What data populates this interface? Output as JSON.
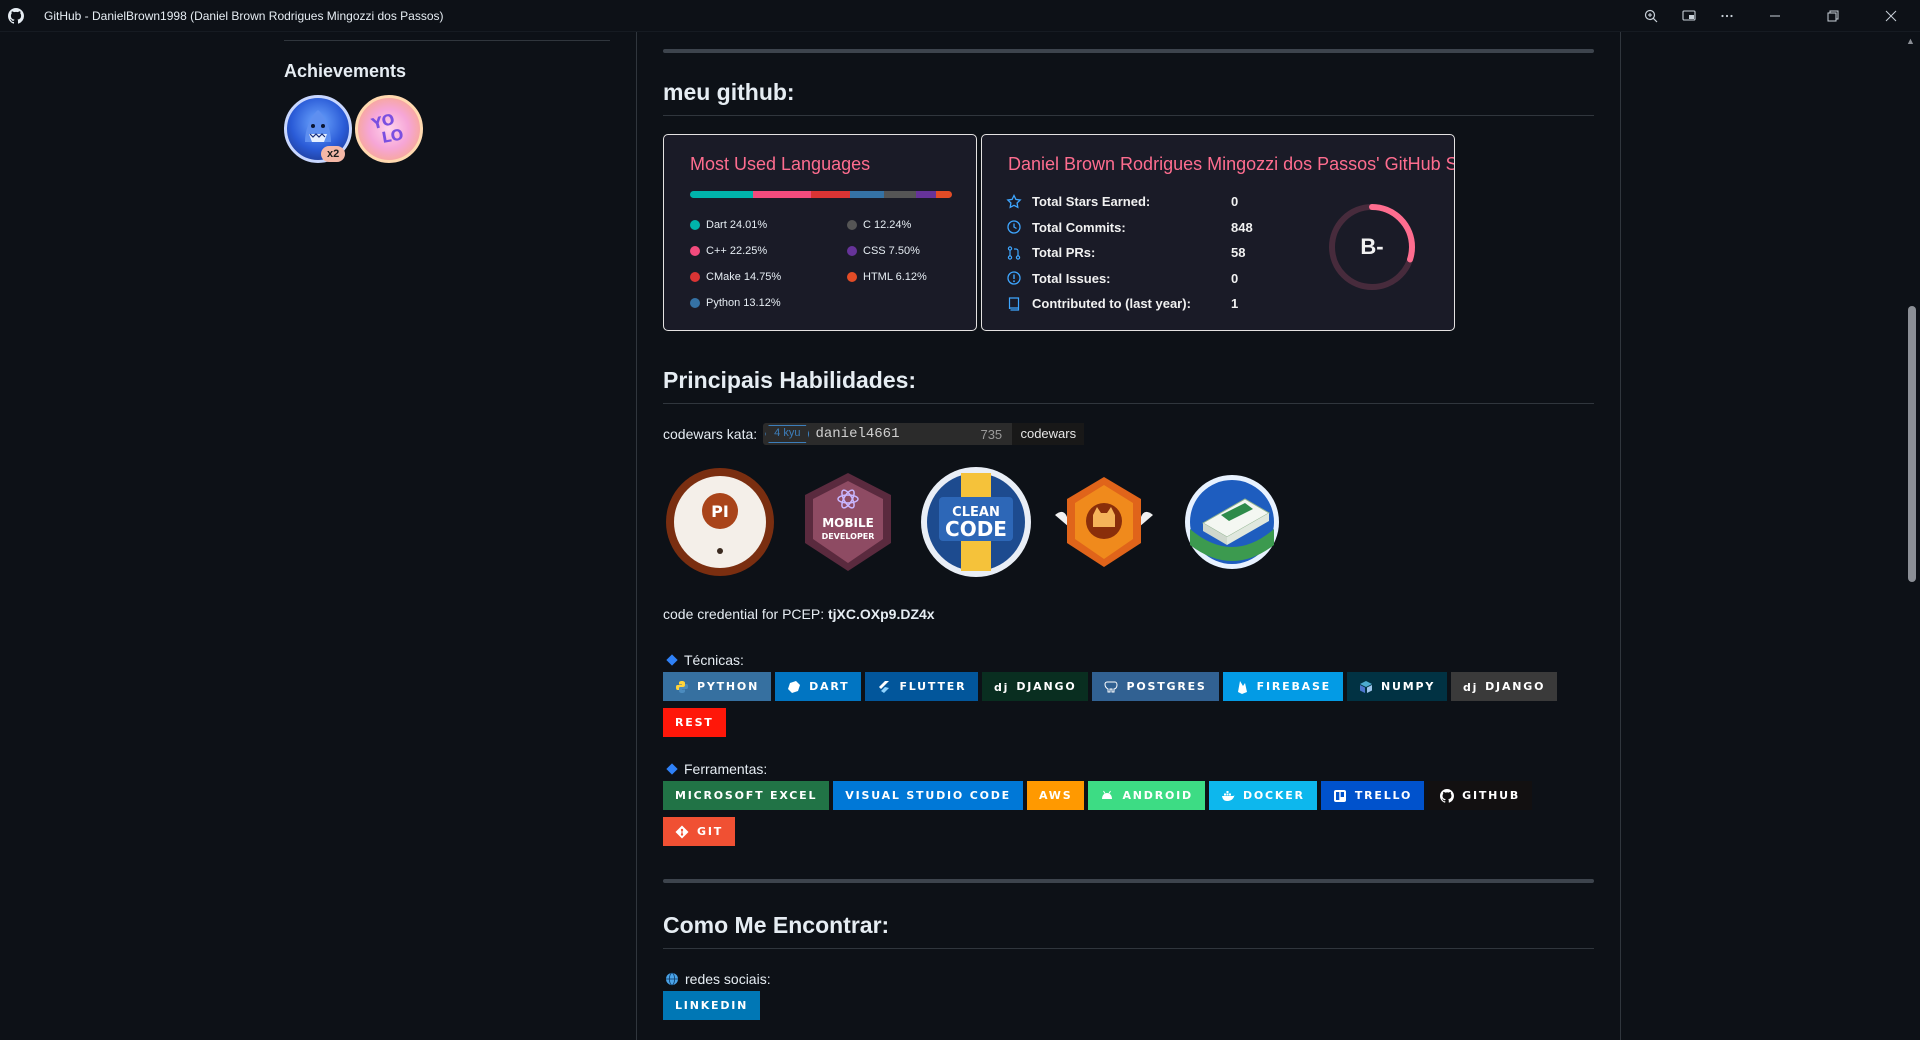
{
  "window": {
    "title": "GitHub - DanielBrown1998 (Daniel Brown Rodrigues Mingozzi dos Passos)",
    "controls": [
      "zoom-icon",
      "cast-icon",
      "more-icon",
      "minimize-icon",
      "restore-icon",
      "close-icon"
    ]
  },
  "sidebar": {
    "achievements_title": "Achievements",
    "badges": [
      {
        "name": "shark",
        "count": "x2"
      },
      {
        "name": "yolo",
        "count": ""
      }
    ]
  },
  "main": {
    "github_title": "meu github:",
    "languages_card": {
      "title": "Most Used Languages",
      "languages": [
        {
          "label": "Dart 24.01%",
          "color": "#00b4ab",
          "percent": 24.01
        },
        {
          "label": "C++ 22.25%",
          "color": "#f34b7d",
          "percent": 22.25
        },
        {
          "label": "CMake 14.75%",
          "color": "#da3434",
          "percent": 14.75
        },
        {
          "label": "Python 13.12%",
          "color": "#3572a5",
          "percent": 13.12
        },
        {
          "label": "C 12.24%",
          "color": "#555555",
          "percent": 12.24
        },
        {
          "label": "CSS 7.50%",
          "color": "#663399",
          "percent": 7.5
        },
        {
          "label": "HTML 6.12%",
          "color": "#e34c26",
          "percent": 6.12
        }
      ]
    },
    "stats_card": {
      "title": "Daniel Brown Rodrigues Mingozzi dos Passos' GitHub Stats",
      "rows": [
        {
          "icon": "star-icon",
          "label": "Total Stars Earned:",
          "value": "0"
        },
        {
          "icon": "history-icon",
          "label": "Total Commits:",
          "value": "848"
        },
        {
          "icon": "pull-request-icon",
          "label": "Total PRs:",
          "value": "58"
        },
        {
          "icon": "issue-icon",
          "label": "Total Issues:",
          "value": "0"
        },
        {
          "icon": "repo-icon",
          "label": "Contributed to (last year):",
          "value": "1"
        }
      ],
      "rank": "B-",
      "rank_progress": 0.3,
      "accent": "#fe6d8f"
    },
    "skills_title": "Principais Habilidades:",
    "codewars": {
      "label": "codewars kata:",
      "kyu": "4 kyu",
      "user": "daniel4661",
      "score": "735",
      "brand": "codewars"
    },
    "certificates": [
      {
        "name": "pcep-certificate"
      },
      {
        "name": "mobile-developer-badge"
      },
      {
        "name": "clean-code-badge"
      },
      {
        "name": "github-badge"
      },
      {
        "name": "cloud-badge"
      }
    ],
    "credential": {
      "label": "code credential for PCEP:",
      "code": "tjXC.OXp9.DZ4x"
    },
    "techniques": {
      "title": "Técnicas:",
      "tags": [
        {
          "label": "PYTHON",
          "bg": "#3670a0",
          "icon": "python-icon"
        },
        {
          "label": "DART",
          "bg": "#0175c2",
          "icon": "dart-icon"
        },
        {
          "label": "FLUTTER",
          "bg": "#02569b",
          "icon": "flutter-icon"
        },
        {
          "label": "DJANGO",
          "bg": "#092e20",
          "icon": "django-icon"
        },
        {
          "label": "POSTGRES",
          "bg": "#316192",
          "icon": "postgres-icon"
        },
        {
          "label": "FIREBASE",
          "bg": "#039be5",
          "icon": "firebase-icon"
        },
        {
          "label": "NUMPY",
          "bg": "#013243",
          "icon": "numpy-icon"
        },
        {
          "label": "DJANGO",
          "bg": "#3a3a3a",
          "icon": "django-icon"
        },
        {
          "label": "REST",
          "bg": "#ff1709",
          "icon": ""
        }
      ]
    },
    "tools": {
      "title": "Ferramentas:",
      "tags": [
        {
          "label": "MICROSOFT EXCEL",
          "bg": "#217346",
          "icon": ""
        },
        {
          "label": "VISUAL STUDIO CODE",
          "bg": "#0078d7",
          "icon": ""
        },
        {
          "label": "AWS",
          "bg": "#ff9900",
          "icon": ""
        },
        {
          "label": "ANDROID",
          "bg": "#3ddc84",
          "icon": "android-icon"
        },
        {
          "label": "DOCKER",
          "bg": "#0db7ed",
          "icon": "docker-icon"
        },
        {
          "label": "TRELLO",
          "bg": "#0052cc",
          "icon": "trello-icon"
        },
        {
          "label": "GITHUB",
          "bg": "#121011",
          "icon": "github-icon"
        },
        {
          "label": "GIT",
          "bg": "#f05033",
          "icon": "git-icon"
        }
      ]
    },
    "find_me_title": "Como Me Encontrar:",
    "social": {
      "label": "redes sociais:",
      "tags": [
        {
          "label": "LINKEDIN",
          "bg": "#0077b5"
        }
      ]
    }
  }
}
